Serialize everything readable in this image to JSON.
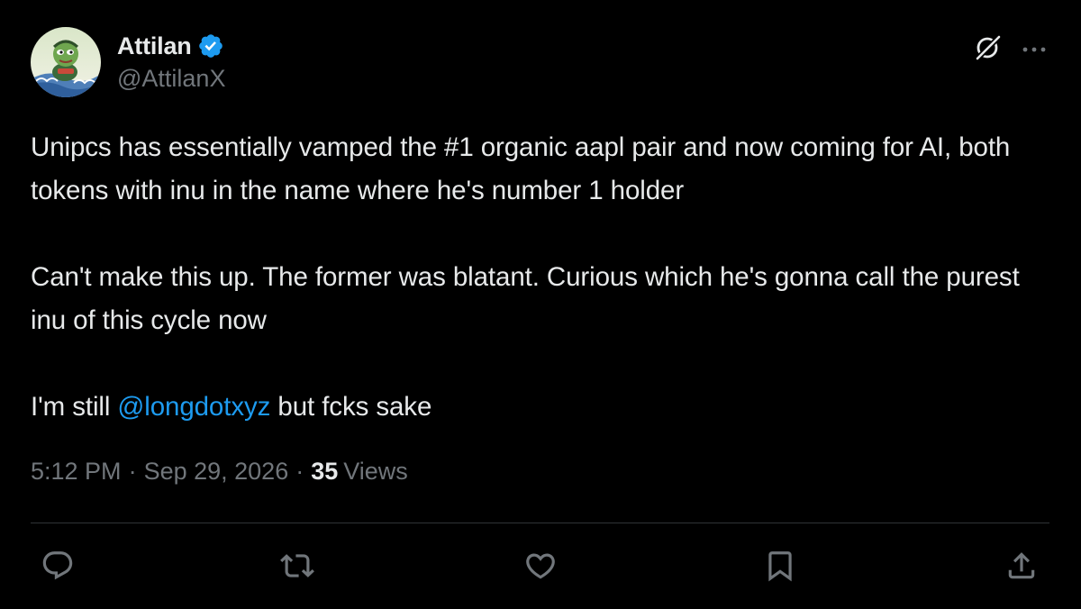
{
  "author": {
    "display_name": "Attilan",
    "handle": "@AttilanX",
    "verified": true
  },
  "tweet": {
    "paragraphs": [
      "Unipcs has essentially vamped the #1 organic aapl pair and now coming for AI, both tokens with inu in the name where he's number 1 holder",
      "Can't make this up. The former was blatant. Curious which he's gonna call the purest inu of this cycle now"
    ],
    "last_line": {
      "prefix": "I'm still ",
      "mention": "@longdotxyz",
      "suffix": " but fcks sake"
    }
  },
  "meta": {
    "time": "5:12 PM",
    "separator": "·",
    "date": "Sep 29, 2026",
    "views_count": "35",
    "views_label": "Views"
  },
  "icons": {
    "top_actions": [
      "grok-icon",
      "more-icon"
    ],
    "action_bar": [
      "reply-icon",
      "retweet-icon",
      "like-icon",
      "bookmark-icon",
      "share-icon"
    ]
  },
  "colors": {
    "background": "#000000",
    "text": "#e7e9ea",
    "secondary": "#71767b",
    "accent": "#1d9bf0",
    "divider": "#2f3336"
  }
}
